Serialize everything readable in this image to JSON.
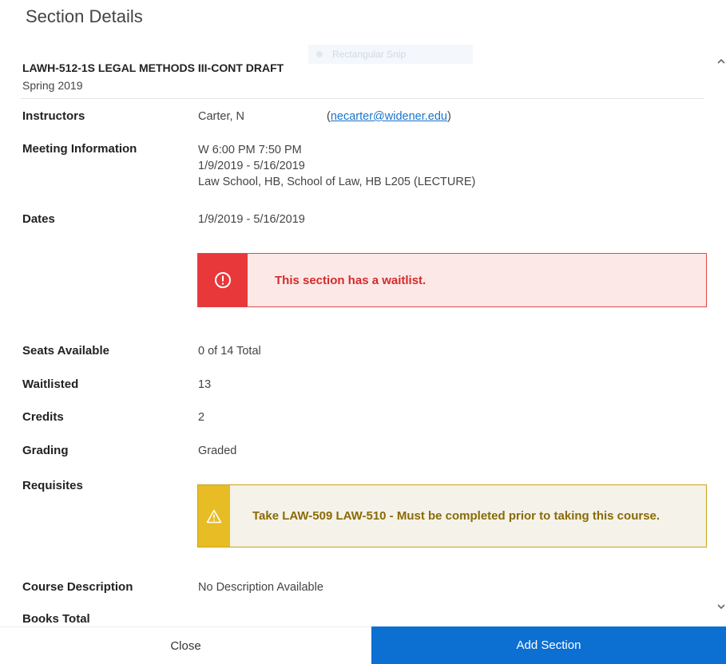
{
  "dialog": {
    "title": "Section Details"
  },
  "background_snip": {
    "label": "Rectangular Snip"
  },
  "section": {
    "course_title": "LAWH-512-1S LEGAL METHODS III-CONT DRAFT",
    "term": "Spring 2019"
  },
  "fields": {
    "instructors": {
      "label": "Instructors",
      "name": "Carter, N",
      "email_prefix": "(",
      "email": "necarter@widener.edu",
      "email_suffix": ")"
    },
    "meeting": {
      "label": "Meeting Information",
      "line1": "W 6:00 PM 7:50 PM",
      "line2": "1/9/2019 - 5/16/2019",
      "line3": "Law School, HB, School of Law, HB L205 (LECTURE)"
    },
    "dates": {
      "label": "Dates",
      "value": "1/9/2019 - 5/16/2019"
    },
    "seats": {
      "label": "Seats Available",
      "value": "0 of 14 Total"
    },
    "waitlisted": {
      "label": "Waitlisted",
      "value": "13"
    },
    "credits": {
      "label": "Credits",
      "value": "2"
    },
    "grading": {
      "label": "Grading",
      "value": "Graded"
    },
    "requisites": {
      "label": "Requisites"
    },
    "description": {
      "label": "Course Description",
      "value": "No Description Available"
    },
    "books": {
      "label": "Books Total"
    }
  },
  "alerts": {
    "waitlist": {
      "text": "This section has a waitlist.",
      "icon": "exclamation-circle-icon",
      "color": "#e8383a"
    },
    "requisite": {
      "text": "Take LAW-509 LAW-510 - Must be completed prior to taking this course.",
      "icon": "warning-triangle-icon",
      "color": "#e8bc25"
    }
  },
  "footer": {
    "close_label": "Close",
    "add_label": "Add Section",
    "accent": "#0c6fd2"
  }
}
